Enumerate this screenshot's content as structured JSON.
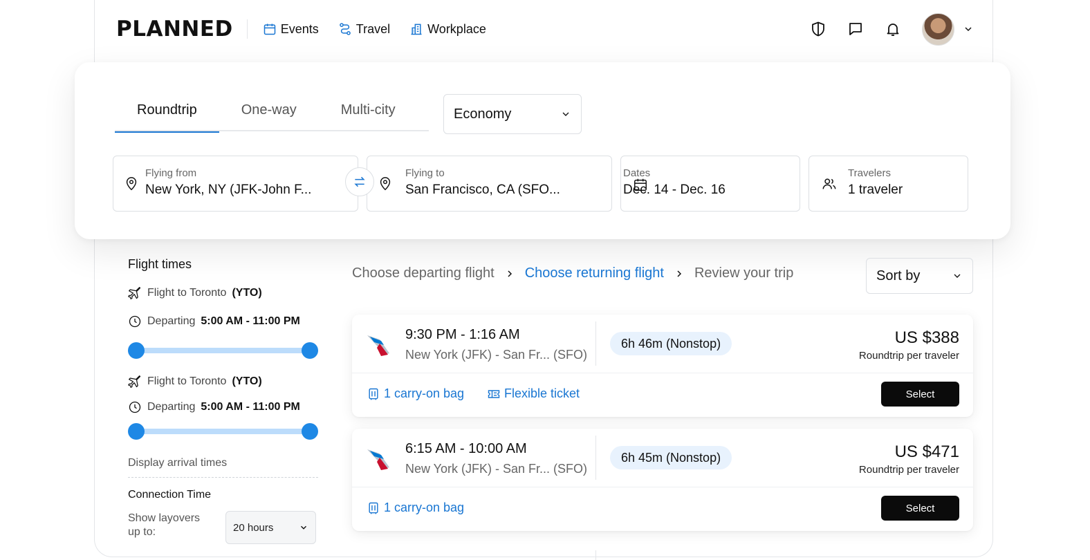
{
  "header": {
    "logo": "PLANNED",
    "nav": [
      {
        "label": "Events",
        "icon": "calendar-icon"
      },
      {
        "label": "Travel",
        "icon": "route-icon"
      },
      {
        "label": "Workplace",
        "icon": "building-icon"
      }
    ],
    "icons": [
      "shield-icon",
      "chat-icon",
      "bell-icon",
      "chevron-down-icon"
    ]
  },
  "search": {
    "tabs": [
      "Roundtrip",
      "One-way",
      "Multi-city"
    ],
    "active_tab": "Roundtrip",
    "cabin": "Economy",
    "from": {
      "label": "Flying from",
      "value": "New York, NY (JFK-John F..."
    },
    "to": {
      "label": "Flying to",
      "value": "San Francisco, CA (SFO..."
    },
    "dates": {
      "label": "Dates",
      "value": "Dec. 14 - Dec. 16"
    },
    "travelers": {
      "label": "Travelers",
      "value": "1 traveler"
    }
  },
  "filters": {
    "title": "Flight times",
    "groups": [
      {
        "flight_prefix": "Flight to Toronto",
        "flight_code": "(YTO)",
        "depart_prefix": "Departing",
        "depart_range": "5:00 AM - 11:00 PM",
        "range_start": 0.0,
        "range_end": 1.0
      },
      {
        "flight_prefix": "Flight to Toronto",
        "flight_code": "(YTO)",
        "depart_prefix": "Departing",
        "depart_range": "5:00 AM - 11:00 PM",
        "range_start": 0.0,
        "range_end": 1.0
      }
    ],
    "arrival_link": "Display arrival times",
    "connection_title": "Connection Time",
    "layover_label_1": "Show layovers",
    "layover_label_2": "up to:",
    "layover_value": "20 hours"
  },
  "breadcrumb": {
    "steps": [
      "Choose departing flight",
      "Choose returning flight",
      "Review your trip"
    ],
    "current_index": 1
  },
  "sort": {
    "label": "Sort by"
  },
  "flights": [
    {
      "times": "9:30 PM - 1:16 AM",
      "route": "New York (JFK) - San Fr... (SFO)",
      "duration": "6h 46m (Nonstop)",
      "price": "US $388",
      "price_note": "Roundtrip per traveler",
      "perks": [
        "1 carry-on bag",
        "Flexible ticket"
      ],
      "select": "Select"
    },
    {
      "times": "6:15 AM - 10:00 AM",
      "route": "New York (JFK) - San Fr... (SFO)",
      "duration": "6h 45m (Nonstop)",
      "price": "US $471",
      "price_note": "Roundtrip per traveler",
      "perks": [
        "1 carry-on bag"
      ],
      "select": "Select"
    }
  ],
  "colors": {
    "accent": "#1976d2",
    "slider_knob": "#1e88e5",
    "slider_track": "#bcdcfb",
    "duration_pill": "#e8f2fd",
    "select_button": "#0b0b0b",
    "airline_red": "#c8102e",
    "airline_blue": "#0078d2"
  }
}
